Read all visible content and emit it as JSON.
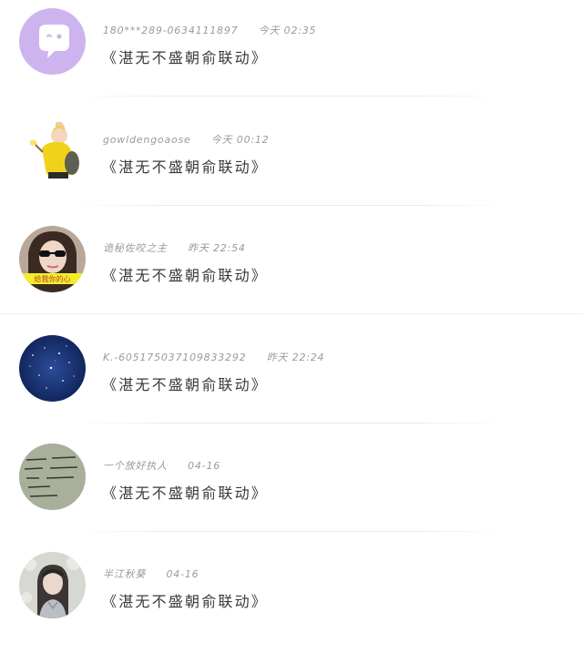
{
  "comments": [
    {
      "username": "180***289-0634111897",
      "time": "今天 02:35",
      "text": "《湛无不盛朝俞联动》",
      "avatar_icon": "chat-bubble-avatar-icon",
      "avatar_color": "#cdb4ee"
    },
    {
      "username": "gowldengoaose",
      "time": "今天 00:12",
      "text": "《湛无不盛朝俞联动》",
      "avatar_icon": "cartoon-character-avatar",
      "avatar_color": "#f2d21b"
    },
    {
      "username": "诡秘佐咬之主",
      "time": "昨天 22:54",
      "text": "《湛无不盛朝俞联动》",
      "avatar_icon": "girl-sunglasses-avatar",
      "avatar_color": "#3a2a22",
      "avatar_caption": "给我你的心"
    },
    {
      "username": "K.-605175037109833292",
      "time": "昨天 22:24",
      "text": "《湛无不盛朝俞联动》",
      "avatar_icon": "starry-sky-avatar",
      "avatar_color": "#0f2a66"
    },
    {
      "username": "一个放好执人",
      "time": "04-16",
      "text": "《湛无不盛朝俞联动》",
      "avatar_icon": "handwritten-note-avatar",
      "avatar_color": "#9aa48f"
    },
    {
      "username": "半江秋葵",
      "time": "04-16",
      "text": "《湛无不盛朝俞联动》",
      "avatar_icon": "ancient-style-portrait-avatar",
      "avatar_color": "#c9c9c4"
    }
  ]
}
